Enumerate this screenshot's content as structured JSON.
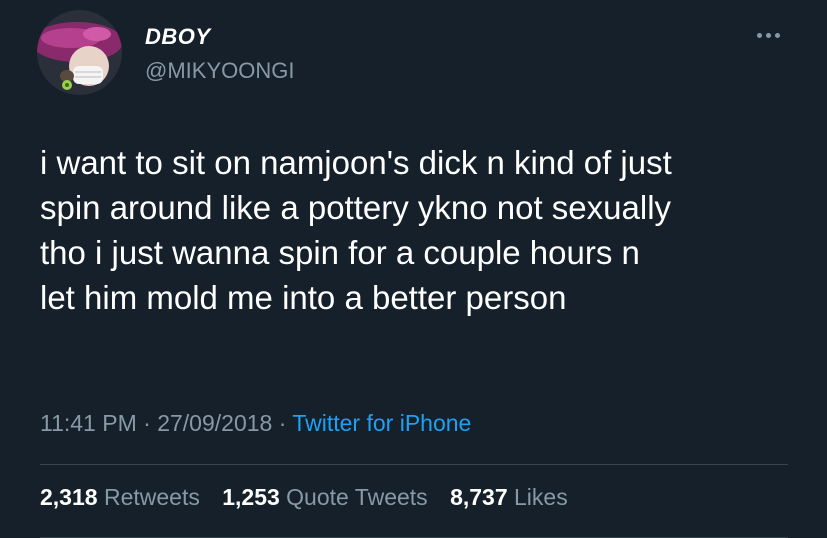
{
  "tweet": {
    "author": {
      "display_name": "DBOY",
      "handle": "@MIKYOONGI",
      "avatar_icon": "user-avatar"
    },
    "more_icon": "more-horizontal-icon",
    "text": "i want to sit on namjoon's dick n kind of just\nspin around like a pottery ykno not sexually\ntho i just wanna spin for a couple hours n\nlet him mold me into a better person",
    "meta": {
      "time": "11:41 PM",
      "separator1": " · ",
      "date": "27/09/2018",
      "separator2": " · ",
      "source": "Twitter for iPhone"
    },
    "stats": {
      "retweets": {
        "count": "2,318",
        "label": "Retweets"
      },
      "quote_tweets": {
        "count": "1,253",
        "label": "Quote Tweets"
      },
      "likes": {
        "count": "8,737",
        "label": "Likes"
      }
    },
    "colors": {
      "background": "#15202b",
      "secondary_text": "#8899a6",
      "link": "#1da1f2",
      "divider": "#38444d"
    }
  }
}
